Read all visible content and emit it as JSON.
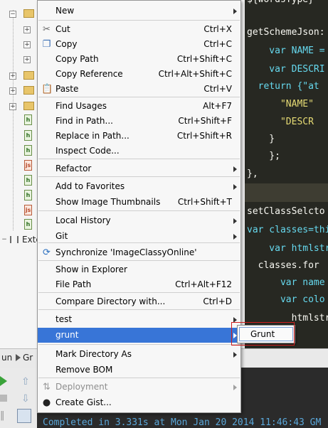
{
  "tree": {
    "ext_label": "Exte"
  },
  "editor": {
    "lines": [
      "${wordsType}",
      "",
      "getSchemeJson:",
      "    var NAME =",
      "    var DESCRI",
      "  return {\"at",
      "      \"NAME\"",
      "      \"DESCR",
      "    }",
      "    };",
      "},",
      "",
      "setClassSelcto",
      "var classes=thi",
      "    var htmlstr",
      "  classes.for",
      "      var name",
      "      var colo",
      "        htmlstr"
    ]
  },
  "bottom": {
    "tab1": "un",
    "tab2": "Gr",
    "console_text": "Completed in 3.331s at Mon Jan 20 2014 11:46:43 GM"
  },
  "menu": {
    "items": [
      {
        "label": "New",
        "shortcut": "",
        "submenu": true,
        "icon": ""
      },
      {
        "label": "Cut",
        "shortcut": "Ctrl+X",
        "submenu": false,
        "icon": "scissors-icon"
      },
      {
        "label": "Copy",
        "shortcut": "Ctrl+C",
        "submenu": false,
        "icon": "copy-icon"
      },
      {
        "label": "Copy Path",
        "shortcut": "Ctrl+Shift+C",
        "submenu": false,
        "icon": ""
      },
      {
        "label": "Copy Reference",
        "shortcut": "Ctrl+Alt+Shift+C",
        "submenu": false,
        "icon": ""
      },
      {
        "label": "Paste",
        "shortcut": "Ctrl+V",
        "submenu": false,
        "icon": "paste-icon"
      },
      {
        "label": "Find Usages",
        "shortcut": "Alt+F7",
        "submenu": false,
        "icon": ""
      },
      {
        "label": "Find in Path...",
        "shortcut": "Ctrl+Shift+F",
        "submenu": false,
        "icon": ""
      },
      {
        "label": "Replace in Path...",
        "shortcut": "Ctrl+Shift+R",
        "submenu": false,
        "icon": ""
      },
      {
        "label": "Inspect Code...",
        "shortcut": "",
        "submenu": false,
        "icon": ""
      },
      {
        "label": "Refactor",
        "shortcut": "",
        "submenu": true,
        "icon": ""
      },
      {
        "label": "Add to Favorites",
        "shortcut": "",
        "submenu": true,
        "icon": ""
      },
      {
        "label": "Show Image Thumbnails",
        "shortcut": "Ctrl+Shift+T",
        "submenu": false,
        "icon": ""
      },
      {
        "label": "Local History",
        "shortcut": "",
        "submenu": true,
        "icon": ""
      },
      {
        "label": "Git",
        "shortcut": "",
        "submenu": true,
        "icon": ""
      },
      {
        "label": "Synchronize 'ImageClassyOnline'",
        "shortcut": "",
        "submenu": false,
        "icon": "sync-icon"
      },
      {
        "label": "Show in Explorer",
        "shortcut": "",
        "submenu": false,
        "icon": ""
      },
      {
        "label": "File Path",
        "shortcut": "Ctrl+Alt+F12",
        "submenu": false,
        "icon": ""
      },
      {
        "label": "Compare Directory with...",
        "shortcut": "Ctrl+D",
        "submenu": false,
        "icon": ""
      },
      {
        "label": "test",
        "shortcut": "",
        "submenu": true,
        "icon": ""
      },
      {
        "label": "grunt",
        "shortcut": "",
        "submenu": true,
        "icon": "",
        "selected": true
      },
      {
        "label": "Mark Directory As",
        "shortcut": "",
        "submenu": true,
        "icon": ""
      },
      {
        "label": "Remove BOM",
        "shortcut": "",
        "submenu": false,
        "icon": ""
      },
      {
        "label": "Deployment",
        "shortcut": "",
        "submenu": true,
        "icon": "deployment-icon",
        "disabled": true
      },
      {
        "label": "Create Gist...",
        "shortcut": "",
        "submenu": false,
        "icon": "github-icon"
      }
    ]
  },
  "submenu": {
    "label": "Grunt"
  },
  "colors": {
    "selection": "#3875d7",
    "highlight_box": "#d01e1e",
    "editor_bg": "#272822"
  }
}
